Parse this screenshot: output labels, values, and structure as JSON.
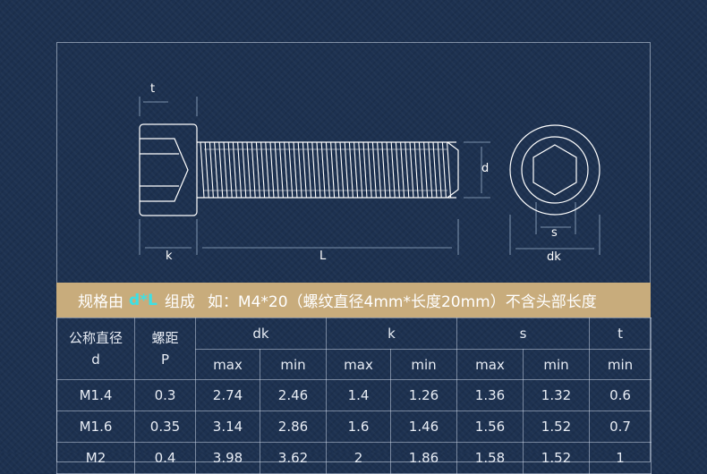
{
  "colors": {
    "background": "#1d3150",
    "banner": "#c8ac7c",
    "highlight": "#3de0e4",
    "line": "#d2dceb"
  },
  "diagram": {
    "label_t": "t",
    "label_k": "k",
    "label_L": "L",
    "label_d": "d",
    "label_s": "s",
    "label_dk": "dk"
  },
  "banner": {
    "prefix": "规格由",
    "highlight": "d*L",
    "middle": "组成",
    "example": "如：M4*20（螺纹直径4mm*长度20mm）不含头部长度"
  },
  "table": {
    "col_nominal": "公称直径",
    "col_nominal_sym": "d",
    "col_pitch": "螺距",
    "col_pitch_sym": "P",
    "groups": [
      "dk",
      "k",
      "s",
      "t"
    ],
    "sub": [
      "max",
      "min",
      "max",
      "min",
      "max",
      "min",
      "min"
    ],
    "rows": [
      [
        "M1.4",
        "0.3",
        "2.74",
        "2.46",
        "1.4",
        "1.26",
        "1.36",
        "1.32",
        "0.6"
      ],
      [
        "M1.6",
        "0.35",
        "3.14",
        "2.86",
        "1.6",
        "1.46",
        "1.56",
        "1.52",
        "0.7"
      ],
      [
        "M2",
        "0.4",
        "3.98",
        "3.62",
        "2",
        "1.86",
        "1.58",
        "1.52",
        "1"
      ]
    ]
  }
}
